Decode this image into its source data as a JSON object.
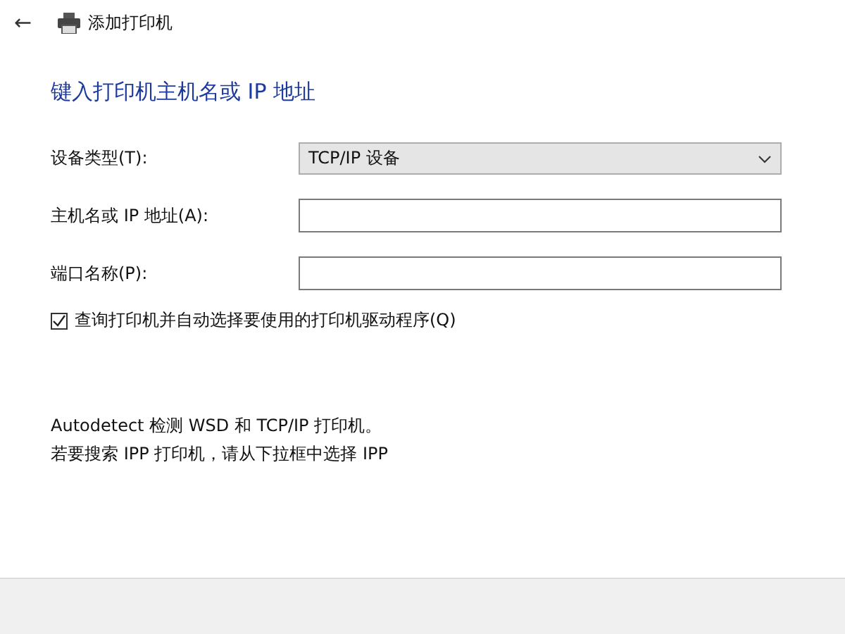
{
  "window": {
    "title": "添加打印机",
    "back_icon": "←"
  },
  "heading": "键入打印机主机名或 IP 地址",
  "fields": [
    {
      "kind": "dropdown",
      "label": "设备类型(T):",
      "value": "TCP/IP 设备"
    },
    {
      "kind": "text",
      "label": "主机名或 IP 地址(A):"
    },
    {
      "kind": "text",
      "label": "端口名称(P):"
    }
  ],
  "auto_select": {
    "label": "查询打印机并自动选择要使用的打印机驱动程序(Q)",
    "checked": true
  },
  "notes": [
    "Autodetect 检测 WSD 和 TCP/IP 打印机。",
    "若要搜索 IPP 打印机，请从下拉框中选择 IPP"
  ]
}
